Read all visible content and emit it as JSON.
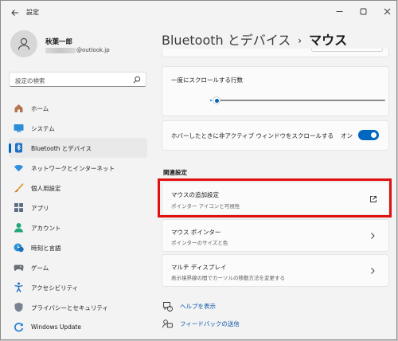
{
  "app": {
    "title": "設定"
  },
  "user": {
    "name": "秋葉一郎",
    "email_suffix": "@outlook.jp"
  },
  "search": {
    "placeholder": "設定の検索"
  },
  "sidebar": {
    "items": [
      {
        "label": "ホーム",
        "icon": "home-icon"
      },
      {
        "label": "システム",
        "icon": "system-icon"
      },
      {
        "label": "Bluetooth とデバイス",
        "icon": "bluetooth-icon",
        "selected": true
      },
      {
        "label": "ネットワークとインターネット",
        "icon": "wifi-icon"
      },
      {
        "label": "個人用設定",
        "icon": "brush-icon"
      },
      {
        "label": "アプリ",
        "icon": "apps-icon"
      },
      {
        "label": "アカウント",
        "icon": "account-icon"
      },
      {
        "label": "時刻と言語",
        "icon": "time-language-icon"
      },
      {
        "label": "ゲーム",
        "icon": "gamepad-icon"
      },
      {
        "label": "アクセシビリティ",
        "icon": "accessibility-icon"
      },
      {
        "label": "プライバシーとセキュリティ",
        "icon": "shield-icon"
      },
      {
        "label": "Windows Update",
        "icon": "windows-update-icon"
      }
    ]
  },
  "breadcrumb": {
    "parent": "Bluetooth とデバイス",
    "separator": "›",
    "current": "マウス"
  },
  "settings": {
    "scroll_lines": {
      "title": "一度にスクロールする行数",
      "value_fraction": 0.02
    },
    "inactive_scroll": {
      "title": "ホバーしたときに非アクティブ ウィンドウをスクロールする",
      "state_label": "オン",
      "on": true
    }
  },
  "related": {
    "header": "関連設定",
    "items": [
      {
        "title": "マウスの追加設定",
        "subtitle": "ポインター アイコンと可視性",
        "icon": "external-link-icon"
      },
      {
        "title": "マウス ポインター",
        "subtitle": "ポインターのサイズと色",
        "icon": "chevron-right-icon"
      },
      {
        "title": "マルチ ディスプレイ",
        "subtitle": "表示境界線の間でカーソルの移動方法を変更する",
        "icon": "chevron-right-icon"
      }
    ]
  },
  "help": {
    "get_help": "ヘルプを表示",
    "feedback": "フィードバックの送信"
  },
  "colors": {
    "accent": "#0067c0",
    "highlight": "#e01010",
    "link": "#0a56a8"
  }
}
